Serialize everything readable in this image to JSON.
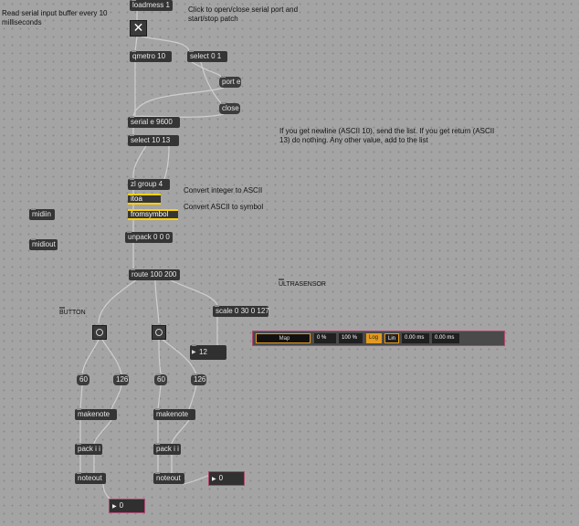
{
  "objects": {
    "loadmess": "loadmess 1",
    "qmetro": "qmetro 10",
    "select01": "select 0 1",
    "port": "port e",
    "close": "close",
    "serial": "serial e 9600",
    "select1013": "select 10 13",
    "zlgroup": "zl group 4",
    "itoa": "itoa",
    "fromsymbol": "fromsymbol",
    "midiin": "midiin",
    "midiout": "midiout",
    "unpack": "unpack 0 0 0",
    "route": "route 100 200",
    "scale": "scale 0 30 0 127",
    "num_scaled": "12",
    "num_60_left": "60",
    "num_126_left": "126",
    "num_60_right": "60",
    "num_126_right": "126",
    "makenote_left": "makenote",
    "makenote_right": "makenote",
    "pack_left": "pack i i",
    "pack_right": "pack i i",
    "noteout_left": "noteout",
    "noteout_right": "noteout",
    "num_out_right": "0",
    "num_out_bottom": "0"
  },
  "comments": {
    "read_serial": "Read serial input buffer every 10 milliseconds",
    "click_open": "Click to open/close serial port and start/stop patch",
    "newline_note": "If you get newline (ASCII 10), send the list. If you get return (ASCII 13) do nothing. Any other value, add to the list",
    "convert_int": "Convert integer to ASCII",
    "convert_symbol": "Convert ASCII to symbol",
    "button_label": "BUTTON",
    "ultrasensor_label": "ULTRASENSOR"
  },
  "toggle": {
    "icon": "x-mark-icon",
    "symbol": "✕"
  },
  "scale_panel": {
    "map": "Map",
    "pct_a": "0 %",
    "pct_b": "100 %",
    "log": "Log",
    "lin": "Lin",
    "ms_a": "0.00 ms",
    "ms_b": "0.00 ms"
  },
  "colors": {
    "canvas": "#a4a4a4",
    "object_box": "#353535",
    "patch_cord": "#c8c8c8",
    "accent_yellow": "#ffd200",
    "accent_orange": "#e39a20",
    "highlight_border": "#b04870"
  }
}
